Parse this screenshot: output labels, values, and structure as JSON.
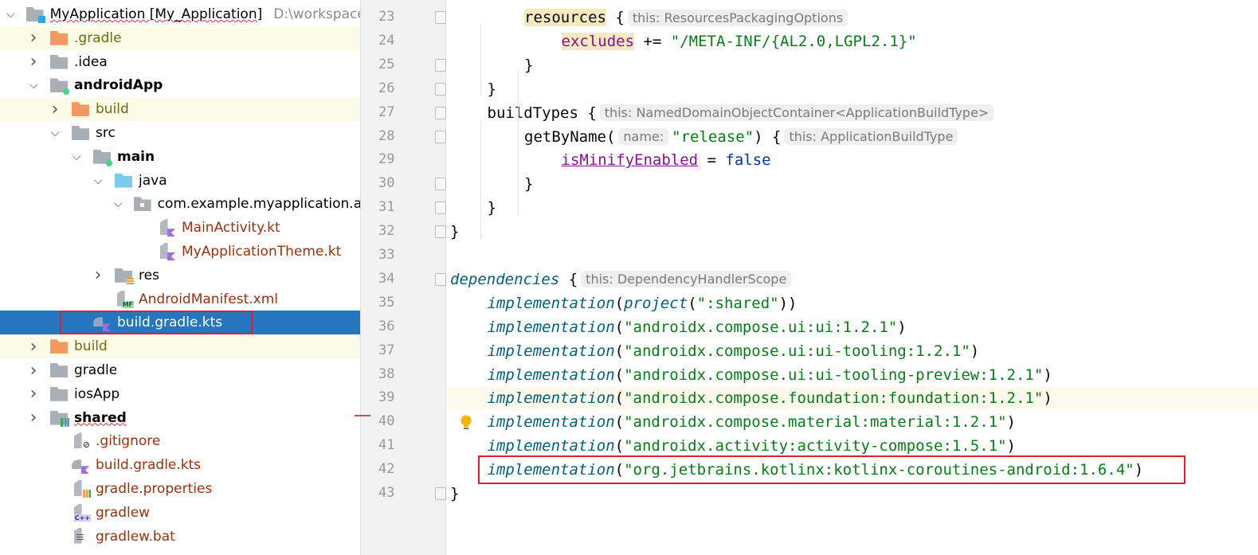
{
  "project_tree": {
    "rows": [
      {
        "label": "MyApplication [My_Application]",
        "path_hint": "D:\\workspace",
        "depth": 0,
        "chevron": "down",
        "icon": "module-folder",
        "bold": false,
        "squiggle": true
      },
      {
        "label": ".gradle",
        "depth": 1,
        "chevron": "right",
        "icon": "folder-orange",
        "color": "olive",
        "highlight": true
      },
      {
        "label": ".idea",
        "depth": 1,
        "chevron": "right",
        "icon": "folder"
      },
      {
        "label": "androidApp",
        "depth": 1,
        "chevron": "down",
        "icon": "module-folder-android",
        "bold": true
      },
      {
        "label": "build",
        "depth": 2,
        "chevron": "right",
        "icon": "folder-orange",
        "color": "olive",
        "highlight": true
      },
      {
        "label": "src",
        "depth": 2,
        "chevron": "down",
        "icon": "folder"
      },
      {
        "label": "main",
        "depth": 3,
        "chevron": "down",
        "icon": "module-folder-android",
        "bold": true
      },
      {
        "label": "java",
        "depth": 4,
        "chevron": "down",
        "icon": "folder-blue"
      },
      {
        "label": "com.example.myapplication.and",
        "depth": 5,
        "chevron": "down",
        "icon": "package"
      },
      {
        "label": "MainActivity.kt",
        "depth": 6,
        "icon": "kotlin-file",
        "color": "red"
      },
      {
        "label": "MyApplicationTheme.kt",
        "depth": 6,
        "icon": "kotlin-file",
        "color": "red"
      },
      {
        "label": "res",
        "depth": 4,
        "chevron": "right",
        "icon": "resources-folder"
      },
      {
        "label": "AndroidManifest.xml",
        "depth": 4,
        "icon": "manifest-file",
        "color": "red"
      },
      {
        "label": "build.gradle.kts",
        "depth": 3,
        "icon": "gradle-kts-file",
        "selected": true,
        "boxed": true
      },
      {
        "label": "build",
        "depth": 1,
        "chevron": "right",
        "icon": "folder-orange",
        "color": "olive",
        "highlight": true
      },
      {
        "label": "gradle",
        "depth": 1,
        "chevron": "right",
        "icon": "folder"
      },
      {
        "label": "iosApp",
        "depth": 1,
        "chevron": "right",
        "icon": "folder"
      },
      {
        "label": "shared",
        "depth": 1,
        "chevron": "right",
        "icon": "module-folder-shared",
        "bold": true,
        "squiggle": true
      },
      {
        "label": ".gitignore",
        "depth": 2,
        "icon": "gitignore-file",
        "color": "red"
      },
      {
        "label": "build.gradle.kts",
        "depth": 2,
        "icon": "gradle-kts-file",
        "color": "red"
      },
      {
        "label": "gradle.properties",
        "depth": 2,
        "icon": "properties-file",
        "color": "red"
      },
      {
        "label": "gradlew",
        "depth": 2,
        "icon": "cpp-file",
        "color": "red"
      },
      {
        "label": "gradlew.bat",
        "depth": 2,
        "icon": "text-file",
        "color": "red"
      }
    ]
  },
  "editor": {
    "current_line": 39,
    "bulb_line": 40,
    "boxed_line": 42,
    "lines": [
      {
        "n": 23,
        "indent": 2,
        "fold": "start",
        "tokens": [
          [
            "mark",
            "resources"
          ],
          [
            "p",
            " {"
          ],
          [
            "hint",
            "this: ResourcesPackagingOptions"
          ]
        ]
      },
      {
        "n": 24,
        "indent": 3,
        "tokens": [
          [
            "markprop",
            "excludes"
          ],
          [
            "p",
            " += "
          ],
          [
            "str",
            "\"/META-INF/{AL2.0,LGPL2.1}\""
          ]
        ]
      },
      {
        "n": 25,
        "indent": 2,
        "fold": "end",
        "tokens": [
          [
            "p",
            "}"
          ]
        ]
      },
      {
        "n": 26,
        "indent": 1,
        "fold": "end",
        "tokens": [
          [
            "p",
            "}"
          ]
        ]
      },
      {
        "n": 27,
        "indent": 1,
        "fold": "start",
        "tokens": [
          [
            "p",
            "buildTypes {"
          ],
          [
            "hint",
            "this: NamedDomainObjectContainer<ApplicationBuildType>"
          ]
        ]
      },
      {
        "n": 28,
        "indent": 2,
        "fold": "start",
        "tokens": [
          [
            "p",
            "getByName("
          ],
          [
            "hint",
            "name:"
          ],
          [
            "str",
            "\"release\""
          ],
          [
            "p",
            ") {"
          ],
          [
            "hint",
            "this: ApplicationBuildType"
          ]
        ]
      },
      {
        "n": 29,
        "indent": 3,
        "tokens": [
          [
            "propu",
            "isMinifyEnabled"
          ],
          [
            "p",
            " = "
          ],
          [
            "bool",
            "false"
          ]
        ]
      },
      {
        "n": 30,
        "indent": 2,
        "fold": "end",
        "tokens": [
          [
            "p",
            "}"
          ]
        ]
      },
      {
        "n": 31,
        "indent": 1,
        "fold": "end",
        "tokens": [
          [
            "p",
            "}"
          ]
        ]
      },
      {
        "n": 32,
        "indent": 0,
        "fold": "end",
        "tokens": [
          [
            "p",
            "}"
          ]
        ]
      },
      {
        "n": 33,
        "indent": 0,
        "tokens": []
      },
      {
        "n": 34,
        "indent": 0,
        "fold": "start",
        "tokens": [
          [
            "fn",
            "dependencies"
          ],
          [
            "p",
            " {"
          ],
          [
            "hint",
            "this: DependencyHandlerScope"
          ]
        ]
      },
      {
        "n": 35,
        "indent": 1,
        "tokens": [
          [
            "fn",
            "implementation"
          ],
          [
            "p",
            "("
          ],
          [
            "fn",
            "project"
          ],
          [
            "p",
            "("
          ],
          [
            "str",
            "\":shared\""
          ],
          [
            "p",
            "))"
          ]
        ]
      },
      {
        "n": 36,
        "indent": 1,
        "tokens": [
          [
            "fn",
            "implementation"
          ],
          [
            "p",
            "("
          ],
          [
            "str",
            "\"androidx.compose.ui:ui:1.2.1\""
          ],
          [
            "p",
            ")"
          ]
        ]
      },
      {
        "n": 37,
        "indent": 1,
        "tokens": [
          [
            "fn",
            "implementation"
          ],
          [
            "p",
            "("
          ],
          [
            "str",
            "\"androidx.compose.ui:ui-tooling:1.2.1\""
          ],
          [
            "p",
            ")"
          ]
        ]
      },
      {
        "n": 38,
        "indent": 1,
        "tokens": [
          [
            "fn",
            "implementation"
          ],
          [
            "p",
            "("
          ],
          [
            "str",
            "\"androidx.compose.ui:ui-tooling-preview:1.2.1\""
          ],
          [
            "p",
            ")"
          ]
        ]
      },
      {
        "n": 39,
        "indent": 1,
        "tokens": [
          [
            "fn",
            "implementation"
          ],
          [
            "p",
            "("
          ],
          [
            "str",
            "\"androidx.compose.foundation:foundation:1.2.1\""
          ],
          [
            "p",
            ")"
          ]
        ]
      },
      {
        "n": 40,
        "indent": 1,
        "tokens": [
          [
            "fn",
            "implementation"
          ],
          [
            "p",
            "("
          ],
          [
            "str",
            "\"androidx.compose.material:material:1.2.1\""
          ],
          [
            "p",
            ")"
          ]
        ]
      },
      {
        "n": 41,
        "indent": 1,
        "tokens": [
          [
            "fn",
            "implementation"
          ],
          [
            "p",
            "("
          ],
          [
            "str",
            "\"androidx.activity:activity-compose:1.5.1\""
          ],
          [
            "p",
            ")"
          ]
        ]
      },
      {
        "n": 42,
        "indent": 1,
        "tokens": [
          [
            "fn",
            "implementation"
          ],
          [
            "p",
            "("
          ],
          [
            "str",
            "\"org.jetbrains.kotlinx:kotlinx-coroutines-android:1.6.4\""
          ],
          [
            "p",
            ")"
          ]
        ]
      },
      {
        "n": 43,
        "indent": 0,
        "fold": "end",
        "tokens": [
          [
            "p",
            "}"
          ]
        ]
      }
    ]
  },
  "colors": {
    "selection": "#2675bf",
    "highlight_box": "#e0202a",
    "string": "#067d17",
    "function": "#00627a",
    "property": "#871094",
    "keyword": "#0033b3"
  }
}
